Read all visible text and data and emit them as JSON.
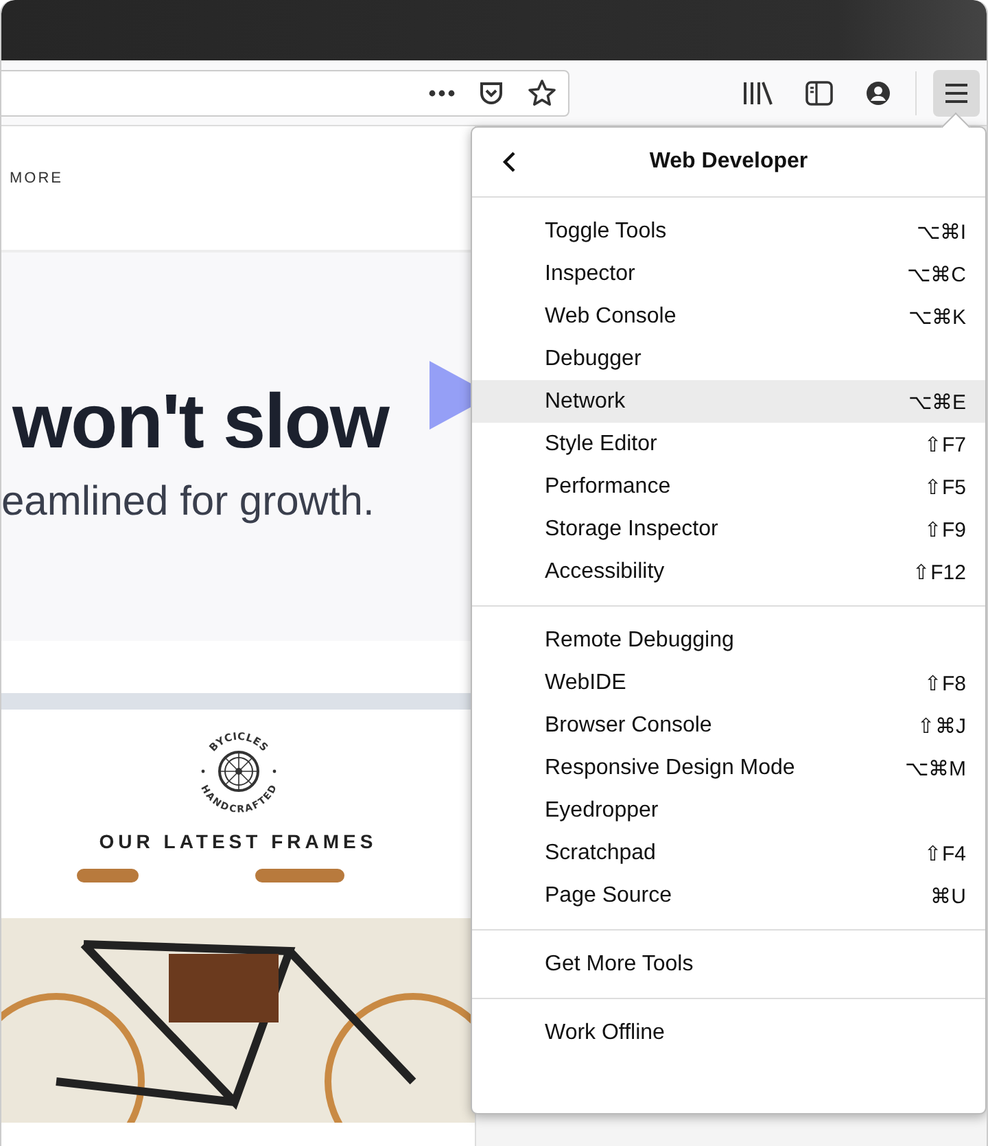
{
  "page": {
    "nav_link": "MORE",
    "headline": "won't slow",
    "subtitle": "eamlined for growth.",
    "logo_top": "BYCICLES",
    "logo_bottom": "HANDCRAFTED",
    "section_title": "OUR LATEST FRAMES"
  },
  "menu": {
    "title": "Web Developer",
    "groups": [
      {
        "items": [
          {
            "label": "Toggle Tools",
            "shortcut": "⌥⌘I",
            "selected": false
          },
          {
            "label": "Inspector",
            "shortcut": "⌥⌘C",
            "selected": false
          },
          {
            "label": "Web Console",
            "shortcut": "⌥⌘K",
            "selected": false
          },
          {
            "label": "Debugger",
            "selected": false
          },
          {
            "label": "Network",
            "shortcut": "⌥⌘E",
            "selected": true
          },
          {
            "label": "Style Editor",
            "shortcut": "⇧F7",
            "selected": false
          },
          {
            "label": "Performance",
            "shortcut": "⇧F5",
            "selected": false
          },
          {
            "label": "Storage Inspector",
            "shortcut": "⇧F9",
            "selected": false
          },
          {
            "label": "Accessibility",
            "shortcut": "⇧F12",
            "selected": false
          }
        ]
      },
      {
        "items": [
          {
            "label": "Remote Debugging",
            "selected": false
          },
          {
            "label": "WebIDE",
            "shortcut": "⇧F8",
            "selected": false
          },
          {
            "label": "Browser Console",
            "shortcut": "⇧⌘J",
            "selected": false
          },
          {
            "label": "Responsive Design Mode",
            "shortcut": "⌥⌘M",
            "selected": false
          },
          {
            "label": "Eyedropper",
            "selected": false
          },
          {
            "label": "Scratchpad",
            "shortcut": "⇧F4",
            "selected": false
          },
          {
            "label": "Page Source",
            "shortcut": "⌘U",
            "selected": false
          }
        ]
      },
      {
        "items": [
          {
            "label": "Get More Tools",
            "selected": false
          }
        ]
      },
      {
        "items": [
          {
            "label": "Work Offline",
            "selected": false
          }
        ]
      }
    ]
  }
}
